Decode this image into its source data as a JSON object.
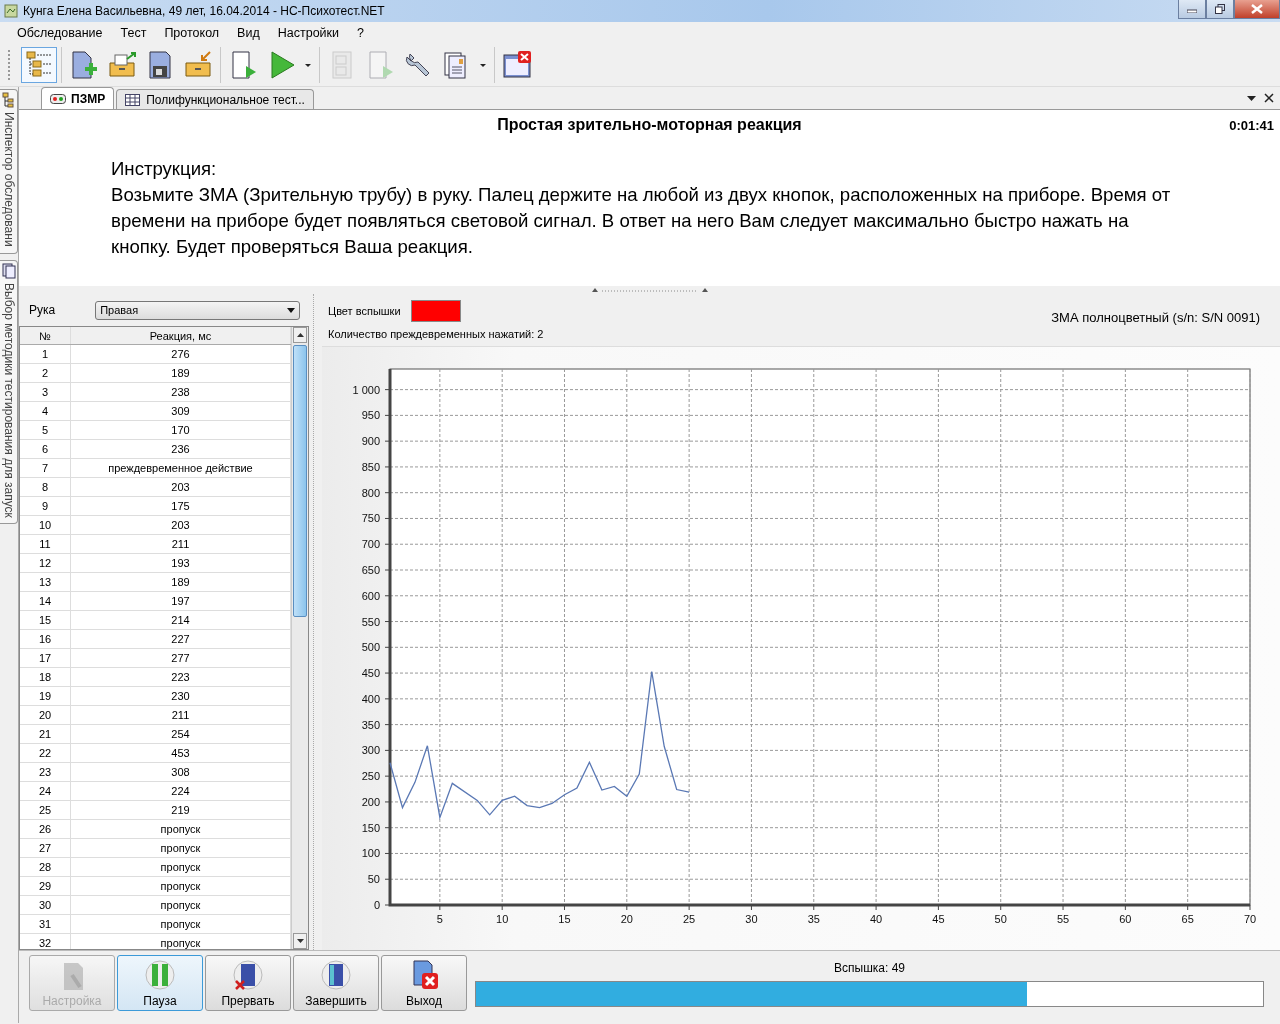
{
  "window": {
    "title": "Кунга Елена Васильевна, 49 лет, 16.04.2014 - НС-Психотест.NET"
  },
  "menu": [
    "Обследование",
    "Тест",
    "Протокол",
    "Вид",
    "Настройки",
    "?"
  ],
  "toolbar": [
    [
      {
        "kind": "tree",
        "selected": true,
        "disabled": false
      }
    ],
    [
      {
        "kind": "new-doc",
        "selected": false,
        "disabled": false
      },
      {
        "kind": "open-box",
        "selected": false,
        "disabled": false
      },
      {
        "kind": "save",
        "selected": false,
        "disabled": false
      },
      {
        "kind": "import-box",
        "selected": false,
        "disabled": false
      }
    ],
    [
      {
        "kind": "doc-play",
        "selected": false,
        "disabled": false
      },
      {
        "kind": "play",
        "selected": false,
        "disabled": false
      },
      {
        "kind": "caret",
        "selected": false,
        "disabled": false
      }
    ],
    [
      {
        "kind": "checklist",
        "selected": false,
        "disabled": true
      },
      {
        "kind": "doc-play",
        "selected": false,
        "disabled": true
      },
      {
        "kind": "wrench",
        "selected": false,
        "disabled": false
      },
      {
        "kind": "report",
        "selected": false,
        "disabled": false
      },
      {
        "kind": "caret",
        "selected": false,
        "disabled": false
      }
    ],
    [
      {
        "kind": "window-close",
        "selected": false,
        "disabled": false
      }
    ]
  ],
  "side_tabs": [
    {
      "label": "Инспектор обследовани",
      "kind": "tree"
    },
    {
      "label": "Выбор методики тестирования для запуск",
      "kind": "pages"
    }
  ],
  "doc_tabs": [
    {
      "label": "ПЗМР",
      "kind": "device",
      "selected": true
    },
    {
      "label": "Полифункциональное тест...",
      "kind": "grid",
      "selected": false
    }
  ],
  "test": {
    "title": "Простая зрительно-моторная реакция",
    "time": "0:01:41"
  },
  "instruction": {
    "heading": "Инструкция:",
    "text": "Возьмите ЗМА (Зрительную трубу) в руку. Палец держите на любой из двух кнопок, расположенных на приборе. Время от времени на приборе будет появляться световой сигнал. В ответ на него Вам следует максимально быстро нажать на кнопку. Будет проверяться Ваша реакция."
  },
  "hand": {
    "label": "Рука",
    "value": "Правая"
  },
  "table": {
    "columns": [
      "№",
      "Реакция, мс"
    ],
    "rows": [
      [
        "1",
        "276"
      ],
      [
        "2",
        "189"
      ],
      [
        "3",
        "238"
      ],
      [
        "4",
        "309"
      ],
      [
        "5",
        "170"
      ],
      [
        "6",
        "236"
      ],
      [
        "7",
        "преждевременное действие"
      ],
      [
        "8",
        "203"
      ],
      [
        "9",
        "175"
      ],
      [
        "10",
        "203"
      ],
      [
        "11",
        "211"
      ],
      [
        "12",
        "193"
      ],
      [
        "13",
        "189"
      ],
      [
        "14",
        "197"
      ],
      [
        "15",
        "214"
      ],
      [
        "16",
        "227"
      ],
      [
        "17",
        "277"
      ],
      [
        "18",
        "223"
      ],
      [
        "19",
        "230"
      ],
      [
        "20",
        "211"
      ],
      [
        "21",
        "254"
      ],
      [
        "22",
        "453"
      ],
      [
        "23",
        "308"
      ],
      [
        "24",
        "224"
      ],
      [
        "25",
        "219"
      ],
      [
        "26",
        "пропуск"
      ],
      [
        "27",
        "пропуск"
      ],
      [
        "28",
        "пропуск"
      ],
      [
        "29",
        "пропуск"
      ],
      [
        "30",
        "пропуск"
      ],
      [
        "31",
        "пропуск"
      ],
      [
        "32",
        "пропуск"
      ]
    ]
  },
  "flash": {
    "label": "Цвет вспышки",
    "color": "#ff0000"
  },
  "premature": "Количество преждевременных нажатий: 2",
  "device": "ЗМА полноцветный (s/n: S/N 0091)",
  "chart_data": {
    "type": "line",
    "x": [
      1,
      2,
      3,
      4,
      5,
      6,
      8,
      9,
      10,
      11,
      12,
      13,
      14,
      15,
      16,
      17,
      18,
      19,
      20,
      21,
      22,
      23,
      24,
      25
    ],
    "grid": true,
    "series": [
      {
        "color": "#5a78b4",
        "values": [
          276,
          189,
          238,
          309,
          170,
          236,
          203,
          175,
          203,
          211,
          193,
          189,
          197,
          214,
          227,
          277,
          223,
          230,
          211,
          254,
          453,
          308,
          224,
          219
        ]
      }
    ],
    "xlim": [
      1,
      70
    ],
    "ylim": [
      0,
      1040
    ],
    "xticks": [
      5,
      10,
      15,
      20,
      25,
      30,
      35,
      40,
      45,
      50,
      55,
      60,
      65,
      70
    ],
    "yticks": [
      0,
      50,
      100,
      150,
      200,
      250,
      300,
      350,
      400,
      450,
      500,
      550,
      600,
      650,
      700,
      750,
      800,
      850,
      900,
      950,
      {
        "value": 1000,
        "label": "1 000"
      }
    ]
  },
  "buttons": [
    {
      "label": "Настройка",
      "kind": "settings",
      "disabled": true,
      "selected": false
    },
    {
      "label": "Пауза",
      "kind": "pause",
      "disabled": false,
      "selected": true
    },
    {
      "label": "Прервать",
      "kind": "abort",
      "disabled": false,
      "selected": false
    },
    {
      "label": "Завершить",
      "kind": "finish",
      "disabled": false,
      "selected": false
    },
    {
      "label": "Выход",
      "kind": "exit",
      "disabled": false,
      "selected": false
    }
  ],
  "progress": {
    "label": "Вспышка: 49",
    "level": 0.7
  }
}
